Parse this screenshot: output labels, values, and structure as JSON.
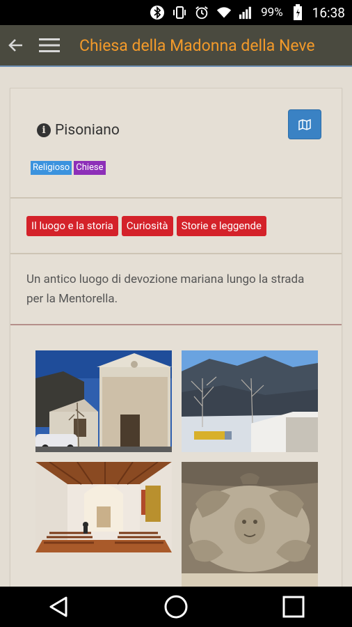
{
  "status_bar": {
    "battery_percent": "99%",
    "time": "16:38",
    "icons": [
      "bluetooth-icon",
      "vibrate-icon",
      "alarm-icon",
      "wifi-icon",
      "signal-icon",
      "battery-icon"
    ]
  },
  "app_bar": {
    "title": "Chiesa della Madonna della Neve",
    "title_color": "#f39a2a",
    "background": "#4a4a3f"
  },
  "place": {
    "name": "Pisoniano"
  },
  "tags": [
    {
      "label": "Religioso",
      "color": "#3b93de"
    },
    {
      "label": "Chiese",
      "color": "#8d2fb8"
    }
  ],
  "categories": [
    {
      "label": "Il luogo e la storia"
    },
    {
      "label": "Curiosità"
    },
    {
      "label": "Storie e leggende"
    }
  ],
  "category_color": "#d4222a",
  "description": "Un antico luogo di devozione mariana lungo la strada per la Mentorella.",
  "gallery": [
    {
      "name": "church-facade-photo"
    },
    {
      "name": "mountain-road-photo"
    },
    {
      "name": "church-interior-photo"
    },
    {
      "name": "stone-capital-photo"
    }
  ]
}
